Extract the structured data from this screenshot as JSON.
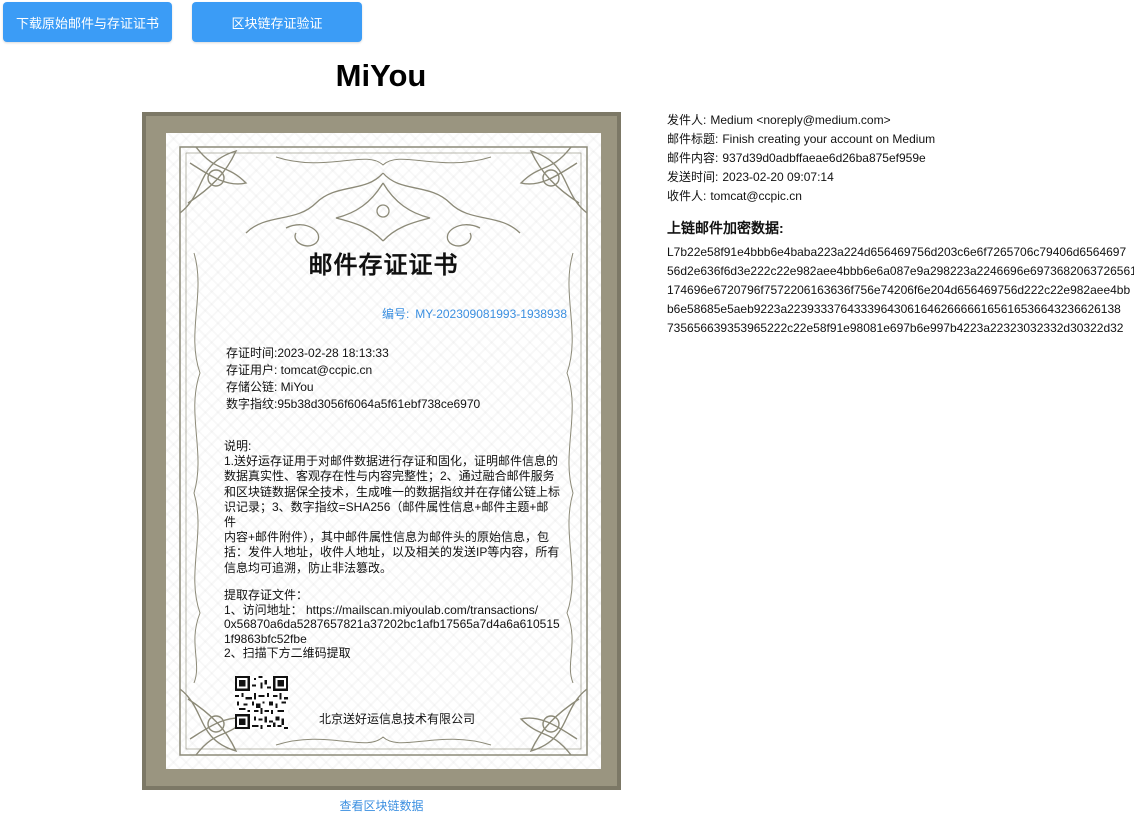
{
  "toolbar": {
    "download_label": "下载原始邮件与存证证书",
    "verify_label": "区块链存证验证"
  },
  "app_title": "MiYou",
  "certificate": {
    "heading": "邮件存证证书",
    "number_label": "编号:",
    "number_value": "MY-202309081993-1938938",
    "fields": [
      "存证时间:2023-02-28 18:13:33",
      "存证用户: tomcat@ccpic.cn",
      "存储公链: MiYou",
      "数字指纹:95b38d3056f6064a5f61ebf738ce6970"
    ],
    "description": [
      "说明:",
      "1.送好运存证用于对邮件数据进行存证和固化，证明邮件信息的",
      "数据真实性、客观存在性与内容完整性；2、通过融合邮件服务",
      "和区块链数据保全技术，生成唯一的数据指纹并在存储公链上标",
      "识记录；3、数字指纹=SHA256（邮件属性信息+邮件主题+邮件",
      "内容+邮件附件），其中邮件属性信息为邮件头的原始信息，包",
      "括：发件人地址，收件人地址，以及相关的发送IP等内容，所有",
      "信息均可追溯，防止非法篡改。"
    ],
    "retrieve": [
      "提取存证文件：",
      "1、访问地址： https://mailscan.miyoulab.com/transactions/",
      "0x56870a6da5287657821a37202bc1afb17565a7d4a6a610515",
      "1f9863bfc52fbe",
      "2、扫描下方二维码提取"
    ],
    "company": "北京送好运信息技术有限公司",
    "qr_icon": "qr-code-icon"
  },
  "view_chain_link": "查看区块链数据",
  "email_meta": [
    {
      "label": "发件人:",
      "value": "Medium <noreply@medium.com>"
    },
    {
      "label": "邮件标题:",
      "value": "Finish creating your account on Medium"
    },
    {
      "label": "邮件内容:",
      "value": "937d39d0adbffaeae6d26ba875ef959e"
    },
    {
      "label": "发送时间:",
      "value": "2023-02-20 09:07:14"
    },
    {
      "label": "收件人:",
      "value": "tomcat@ccpic.cn"
    }
  ],
  "encrypted": {
    "title": "上链邮件加密数据:",
    "lines": [
      "L7b22e58f91e4bbb6e4baba223a224d656469756d203c6e6f7265706c79406d6564697",
      "56d2e636f6d3e222c22e982aee4bbb6e6a087e9a298223a2246696e6973682063726561",
      "174696e6720796f7572206163636f756e74206f6e204d656469756d222c22e982aee4bb",
      "b6e58685e5aeb9223a22393337643339643061646266666165616536643236626138",
      "735656639353965222c22e58f91e98081e697b6e997b4223a22323032332d30322d32"
    ]
  },
  "colors": {
    "accent": "#3b9cf6",
    "link": "#3b8fe0",
    "frame": "#9a9580",
    "ornament": "#8c8a78"
  }
}
